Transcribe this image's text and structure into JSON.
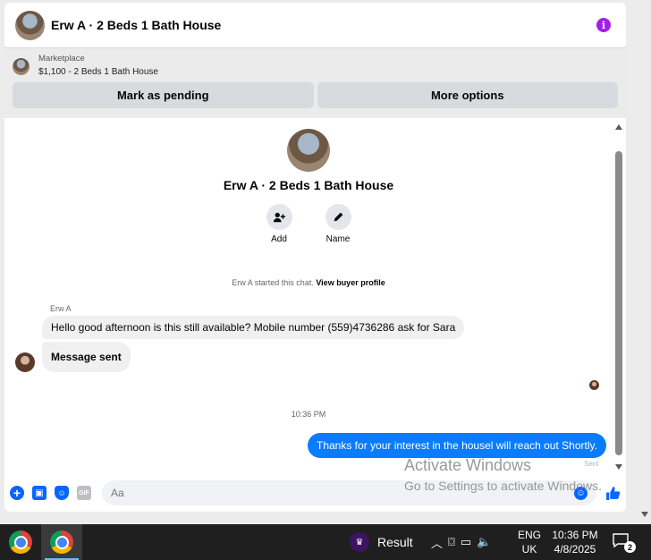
{
  "header": {
    "title": "Erw A · 2 Beds 1 Bath House",
    "info_glyph": "i"
  },
  "marketplace": {
    "label": "Marketplace",
    "listing": "$1,100 - 2 Beds 1 Bath House",
    "buttons": [
      "Mark as pending",
      "More options"
    ]
  },
  "intro": {
    "title": "Erw A · 2 Beds 1 Bath House",
    "actions": [
      {
        "label": "Add",
        "icon": "add-person-icon"
      },
      {
        "label": "Name",
        "icon": "pencil-icon"
      }
    ]
  },
  "system": {
    "text": "Erw A started this chat.",
    "link": "View buyer profile"
  },
  "messages": {
    "sender": "Erw A",
    "in1": "Hello good afternoon is this still available? Mobile number (559)4736286 ask for Sara",
    "in2": "Message sent",
    "time": "10:36 PM",
    "out1": "Thanks for your interest in the housel will reach out Shortly.",
    "status": "Sent"
  },
  "composer": {
    "placeholder": "Aa",
    "gif_label": "GIF"
  },
  "watermark": {
    "line1": "Activate Windows",
    "line2": "Go to Settings to activate Windows."
  },
  "taskbar": {
    "result_label": "Result",
    "lang": [
      "ENG",
      "UK"
    ],
    "time": "10:36 PM",
    "date": "4/8/2025",
    "notifications": "2"
  },
  "colors": {
    "accent": "#0866ff",
    "bubble_out": "#0a7cff",
    "info": "#a020f0"
  }
}
